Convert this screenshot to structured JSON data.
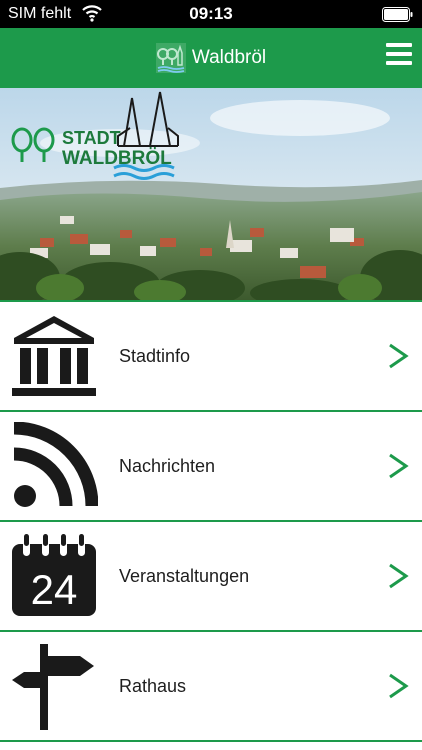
{
  "status_bar": {
    "carrier": "SIM fehlt",
    "time": "09:13"
  },
  "nav": {
    "title": "Waldbröl",
    "logo_icon": "town-logo-icon",
    "menu_icon": "hamburger-menu-icon"
  },
  "banner": {
    "logo_line1": "STADT",
    "logo_line2": "WALDBRÖL"
  },
  "menu": {
    "items": [
      {
        "label": "Stadtinfo",
        "icon": "museum-building-icon"
      },
      {
        "label": "Nachrichten",
        "icon": "rss-feed-icon"
      },
      {
        "label": "Veranstaltungen",
        "icon": "calendar-24-icon",
        "icon_text": "24"
      },
      {
        "label": "Rathaus",
        "icon": "signpost-icon"
      }
    ],
    "chevron_icon": "chevron-right-icon"
  },
  "colors": {
    "brand_green": "#1d9a4b",
    "icon_dark": "#1a1a1a"
  }
}
